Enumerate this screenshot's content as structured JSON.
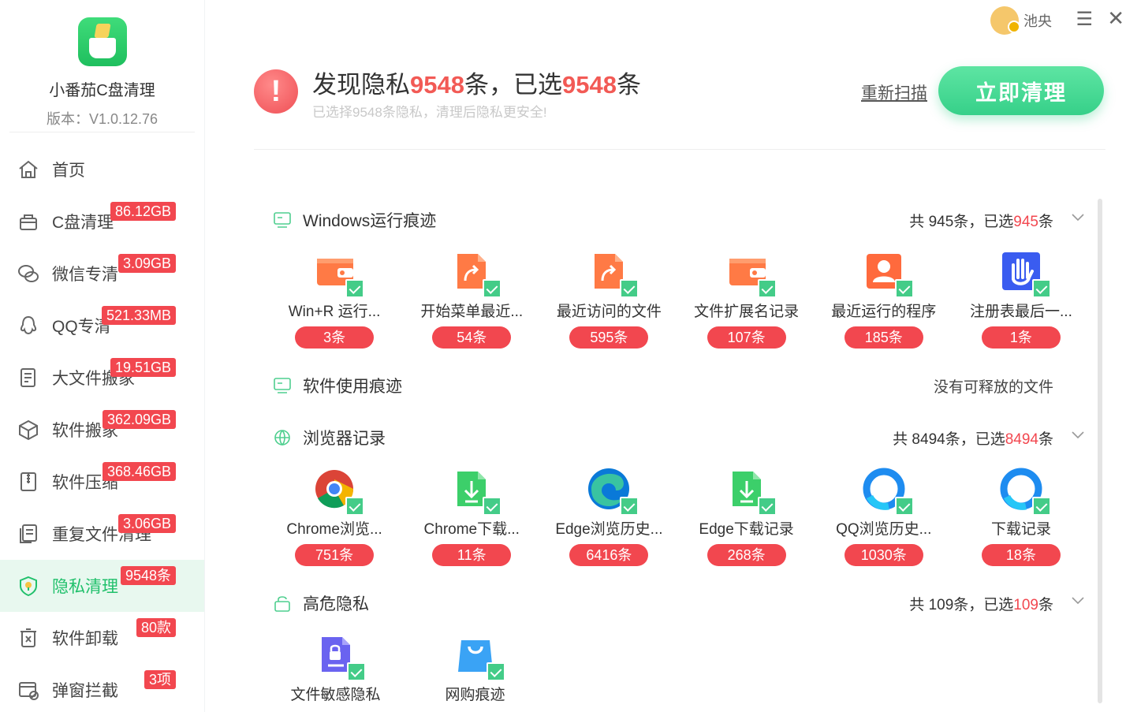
{
  "app": {
    "name": "小番茄C盘清理",
    "version": "版本：V1.0.12.76"
  },
  "sidebar": {
    "items": [
      {
        "label": "首页",
        "badge": "",
        "icon": "home-icon"
      },
      {
        "label": "C盘清理",
        "badge": "86.12GB",
        "icon": "trash-basket-icon"
      },
      {
        "label": "微信专清",
        "badge": "3.09GB",
        "icon": "wechat-icon"
      },
      {
        "label": "QQ专清",
        "badge": "521.33MB",
        "icon": "qq-icon"
      },
      {
        "label": "大文件搬家",
        "badge": "19.51GB",
        "icon": "file-move-icon"
      },
      {
        "label": "软件搬家",
        "badge": "362.09GB",
        "icon": "box-icon"
      },
      {
        "label": "软件压缩",
        "badge": "368.46GB",
        "icon": "zip-icon"
      },
      {
        "label": "重复文件清理",
        "badge": "3.06GB",
        "icon": "duplicate-icon"
      },
      {
        "label": "隐私清理",
        "badge": "9548条",
        "icon": "privacy-shield-icon",
        "active": true
      },
      {
        "label": "软件卸载",
        "badge": "80款",
        "icon": "uninstall-icon"
      },
      {
        "label": "弹窗拦截",
        "badge": "3项",
        "icon": "popup-block-icon"
      }
    ]
  },
  "topbar": {
    "username": "池央",
    "menu_icon": "menu-icon",
    "close_icon": "close-icon"
  },
  "summary": {
    "title_prefix": "发现隐私",
    "found_count": "9548",
    "title_mid": "条，已选",
    "selected_count": "9548",
    "title_suffix": "条",
    "subtitle": "已选择9548条隐私，清理后隐私更安全!",
    "rescan_label": "重新扫描",
    "clean_label": "立即清理"
  },
  "sections": [
    {
      "title": "Windows运行痕迹",
      "right_prefix": "共 945条，已选",
      "right_count": "945",
      "right_suffix": "条",
      "items": [
        {
          "label": "Win+R 运行...",
          "count": "3条",
          "icon": "wallet-orange-icon"
        },
        {
          "label": "开始菜单最近...",
          "count": "54条",
          "icon": "shortcut-file-icon"
        },
        {
          "label": "最近访问的文件",
          "count": "595条",
          "icon": "shortcut-file-icon"
        },
        {
          "label": "文件扩展名记录",
          "count": "107条",
          "icon": "wallet-orange-icon"
        },
        {
          "label": "最近运行的程序",
          "count": "185条",
          "icon": "user-card-icon"
        },
        {
          "label": "注册表最后一...",
          "count": "1条",
          "icon": "hand-stop-icon"
        }
      ]
    },
    {
      "title": "软件使用痕迹",
      "right_text": "没有可释放的文件"
    },
    {
      "title": "浏览器记录",
      "right_prefix": "共 8494条，已选",
      "right_count": "8494",
      "right_suffix": "条",
      "items": [
        {
          "label": "Chrome浏览...",
          "count": "751条",
          "icon": "chrome-icon"
        },
        {
          "label": "Chrome下载...",
          "count": "11条",
          "icon": "download-file-icon"
        },
        {
          "label": "Edge浏览历史...",
          "count": "6416条",
          "icon": "edge-icon"
        },
        {
          "label": "Edge下载记录",
          "count": "268条",
          "icon": "download-file-icon"
        },
        {
          "label": "QQ浏览历史...",
          "count": "1030条",
          "icon": "qq-browser-icon"
        },
        {
          "label": "下载记录",
          "count": "18条",
          "icon": "qq-browser-icon"
        }
      ]
    },
    {
      "title": "高危隐私",
      "right_prefix": "共 109条，已选",
      "right_count": "109",
      "right_suffix": "条",
      "items": [
        {
          "label": "文件敏感隐私",
          "count": "",
          "icon": "locked-file-icon"
        },
        {
          "label": "网购痕迹",
          "count": "",
          "icon": "shopping-bag-icon"
        }
      ]
    }
  ],
  "colors": {
    "accent_green": "#36d089",
    "badge_red": "#f2474f",
    "active_bg": "#e8f8ef"
  }
}
